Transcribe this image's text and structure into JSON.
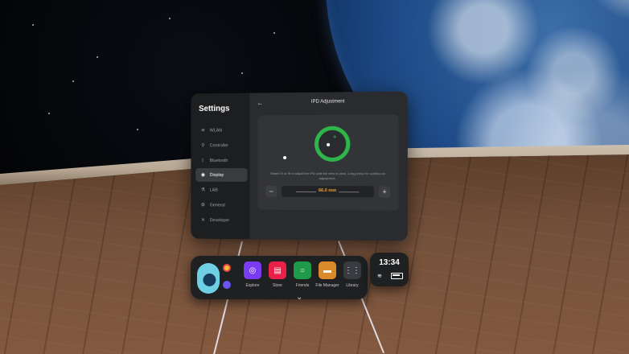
{
  "settings": {
    "title": "Settings",
    "sidebar": [
      {
        "label": "WLAN",
        "icon": "wifi-icon"
      },
      {
        "label": "Controller",
        "icon": "controller-icon"
      },
      {
        "label": "Bluetooth",
        "icon": "bluetooth-icon"
      },
      {
        "label": "Display",
        "icon": "eye-icon",
        "active": true
      },
      {
        "label": "LAB",
        "icon": "flask-icon"
      },
      {
        "label": "General",
        "icon": "gear-icon"
      },
      {
        "label": "Developer",
        "icon": "tools-icon"
      }
    ],
    "page_title": "IPD Adjustment",
    "instruction": "Based ⊖ or ⊕ to adjust the IPD until the view is clear. Long press for continuous adjustment.",
    "ipd_value": "66.0 mm",
    "minus_label": "−",
    "plus_label": "+"
  },
  "dock": {
    "apps": [
      {
        "label": "Explore",
        "color": "#7a3cf0",
        "icon": "explore-icon"
      },
      {
        "label": "Store",
        "color": "#e8204a",
        "icon": "store-icon"
      },
      {
        "label": "Friends",
        "color": "#1e9a4a",
        "icon": "friends-icon"
      },
      {
        "label": "File Manager",
        "color": "#d98a2a",
        "icon": "folder-icon"
      },
      {
        "label": "Library",
        "color": "#3a3b40",
        "icon": "grid-icon"
      }
    ],
    "time": "13:34"
  },
  "colors": {
    "accent_green": "#2fb64b",
    "value_orange": "#f0a23a"
  }
}
